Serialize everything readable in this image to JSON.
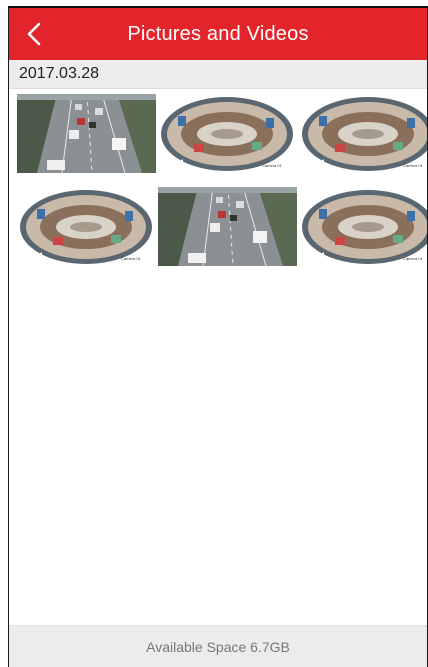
{
  "header": {
    "title": "Pictures and Videos",
    "back_icon": "chevron-left-icon",
    "background": "#e3242b"
  },
  "date_group": {
    "date": "2017.03.28"
  },
  "thumbnails": [
    {
      "type": "picture",
      "scene": "street"
    },
    {
      "type": "video",
      "scene": "fisheye",
      "icon": "video-camera-icon"
    },
    {
      "type": "video",
      "scene": "fisheye",
      "icon": "video-camera-icon"
    },
    {
      "type": "video",
      "scene": "fisheye",
      "icon": "video-camera-icon"
    },
    {
      "type": "picture",
      "scene": "street"
    },
    {
      "type": "video",
      "scene": "fisheye",
      "icon": "video-camera-icon"
    }
  ],
  "footer": {
    "available_space": "Available Space 6.7GB"
  }
}
